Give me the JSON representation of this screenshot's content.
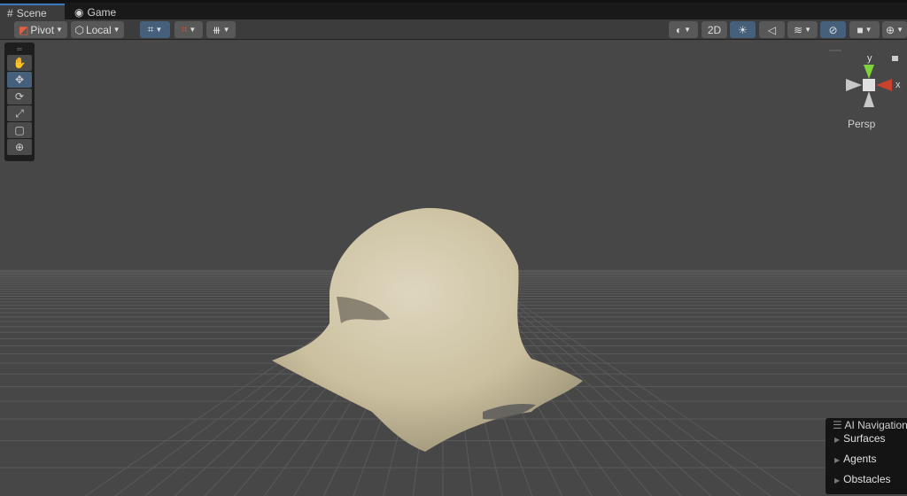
{
  "tabs": [
    {
      "label": "Scene",
      "icon": "grid-icon"
    },
    {
      "label": "Game",
      "icon": "gamepad-icon"
    }
  ],
  "toolbar": {
    "pivot": "Pivot",
    "local": "Local",
    "mode_2d": "2D"
  },
  "tools": [
    "hand",
    "move",
    "rotate",
    "scale",
    "rect",
    "transform"
  ],
  "gizmo": {
    "y": "y",
    "x": "x",
    "projection": "Persp"
  },
  "ai_navigation": {
    "title": "AI Navigation",
    "items": [
      "Surfaces",
      "Agents",
      "Obstacles"
    ]
  },
  "colors": {
    "accent": "#46607c",
    "tab_highlight": "#3a79bb"
  }
}
